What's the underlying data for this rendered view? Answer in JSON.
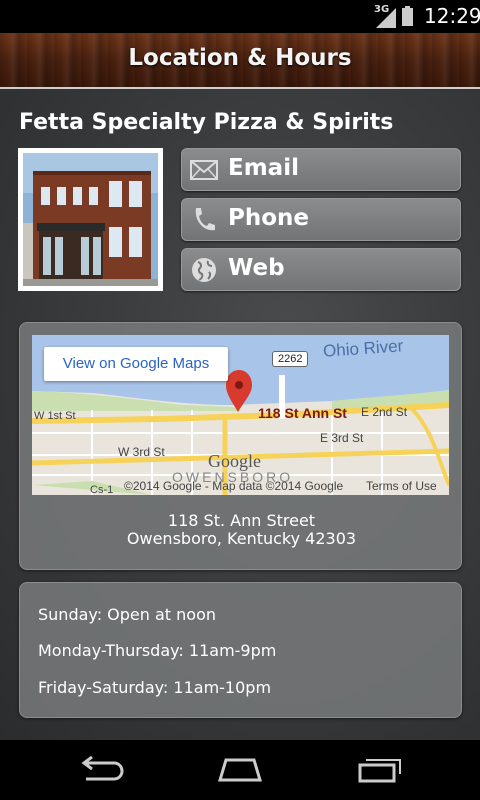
{
  "status_bar": {
    "network": "3G",
    "time": "12:29"
  },
  "header": {
    "title": "Location & Hours"
  },
  "business": {
    "name": "Fetta Specialty Pizza & Spirits"
  },
  "actions": [
    {
      "label": "Email",
      "icon": "email-icon"
    },
    {
      "label": "Phone",
      "icon": "phone-icon"
    },
    {
      "label": "Web",
      "icon": "globe-icon"
    }
  ],
  "map": {
    "button_label": "View on Google Maps",
    "pin_label": "118 St Ann St",
    "river_label": "Ohio River",
    "route_badge": "2262",
    "streets": [
      "W 1st St",
      "E 2nd St",
      "W 3rd St",
      "E 3rd St",
      "Cs-1"
    ],
    "city_label": "OWENSBORO",
    "logo": "Google",
    "copyright": "©2014 Google - Map data ©2014 Google",
    "terms": "Terms of Use"
  },
  "address": {
    "line1": "118 St. Ann Street",
    "line2": "Owensboro, Kentucky 42303"
  },
  "hours": [
    "Sunday: Open at noon",
    "Monday-Thursday: 11am-9pm",
    "Friday-Saturday: 11am-10pm"
  ],
  "colors": {
    "header_wood": "#4a2110",
    "panel": "#787a7b",
    "button": "#7f8182",
    "link_blue": "#2a63c6",
    "pin_red": "#d93a2e"
  }
}
